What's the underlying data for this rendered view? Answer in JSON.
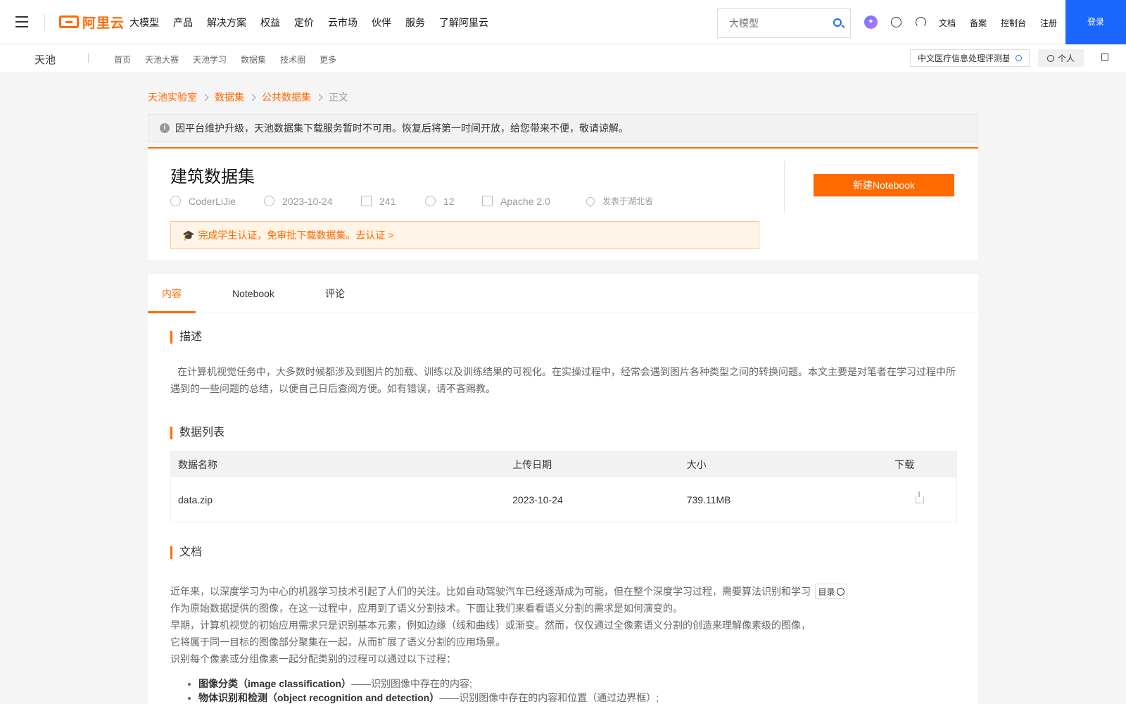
{
  "topnav": {
    "logo_text": "阿里云",
    "menu": [
      "大模型",
      "产品",
      "解决方案",
      "权益",
      "定价",
      "云市场",
      "伙伴",
      "服务",
      "了解阿里云"
    ],
    "search_placeholder": "大模型",
    "links": [
      "文档",
      "备案",
      "控制台",
      "注册"
    ],
    "login_label": "登录",
    "brand_color": "#ff6a00",
    "login_color": "#1a66ff"
  },
  "subnav": {
    "brand": "天池",
    "menu": [
      "首页",
      "天池大赛",
      "天池学习",
      "数据集",
      "技术圈",
      "更多"
    ],
    "search_value": "中文医疗信息处理评测基",
    "personal_label": "个人"
  },
  "breadcrumb": [
    "天池实验室",
    "数据集",
    "公共数据集",
    "正文"
  ],
  "notice": "因平台维护升级，天池数据集下载服务暂时不可用。恢复后将第一时间开放，给您带来不便，敬请谅解。",
  "dataset": {
    "title": "建筑数据集",
    "author": "CoderLiJie",
    "date": "2023-10-24",
    "downloads": "241",
    "citations": "12",
    "license": "Apache 2.0",
    "location": "发表于湖北省",
    "new_notebook_label": "新建Notebook",
    "cert_text": "完成学生认证，免审批下载数据集。去认证 >"
  },
  "tabs": [
    "内容",
    "Notebook",
    "评论"
  ],
  "sections": {
    "desc_title": "描述",
    "desc_text": "在计算机视觉任务中，大多数时候都涉及到图片的加载、训练以及训练结果的可视化。在实操过程中，经常会遇到图片各种类型之间的转换问题。本文主要是对笔者在学习过程中所遇到的一些问题的总结，以便自己日后查阅方便。如有错误，请不吝赐教。",
    "list_title": "数据列表",
    "doc_title": "文档"
  },
  "table": {
    "headers": [
      "数据名称",
      "上传日期",
      "大小",
      "下载"
    ],
    "rows": [
      {
        "name": "data.zip",
        "date": "2023-10-24",
        "size": "739.11MB"
      }
    ]
  },
  "doc": {
    "lines": [
      "近年来，以深度学习为中心的机器学习技术引起了人们的关注。比如自动驾驶汽车已经逐渐成为可能，但在整个深度学习过程，需要算法识别和学习",
      "作为原始数据提供的图像，在这一过程中，应用到了语义分割技术。下面让我们来看看语义分割的需求是如何演变的。",
      "早期，计算机视觉的初始应用需求只是识别基本元素，例如边缘（线和曲线）或渐变。然而，仅仅通过全像素语义分割的创造来理解像素级的图像，",
      "它将属于同一目标的图像部分聚集在一起，从而扩展了语义分割的应用场景。",
      "识别每个像素或分组像素一起分配类别的过程可以通过以下过程："
    ],
    "toc_label": "目录",
    "bullets": [
      {
        "bold": "图像分类（image classification）",
        "text": "——识别图像中存在的内容;"
      },
      {
        "bold": "物体识别和检测（object recognition and detection）",
        "text": "——识别图像中存在的内容和位置（通过边界框）;"
      }
    ]
  }
}
